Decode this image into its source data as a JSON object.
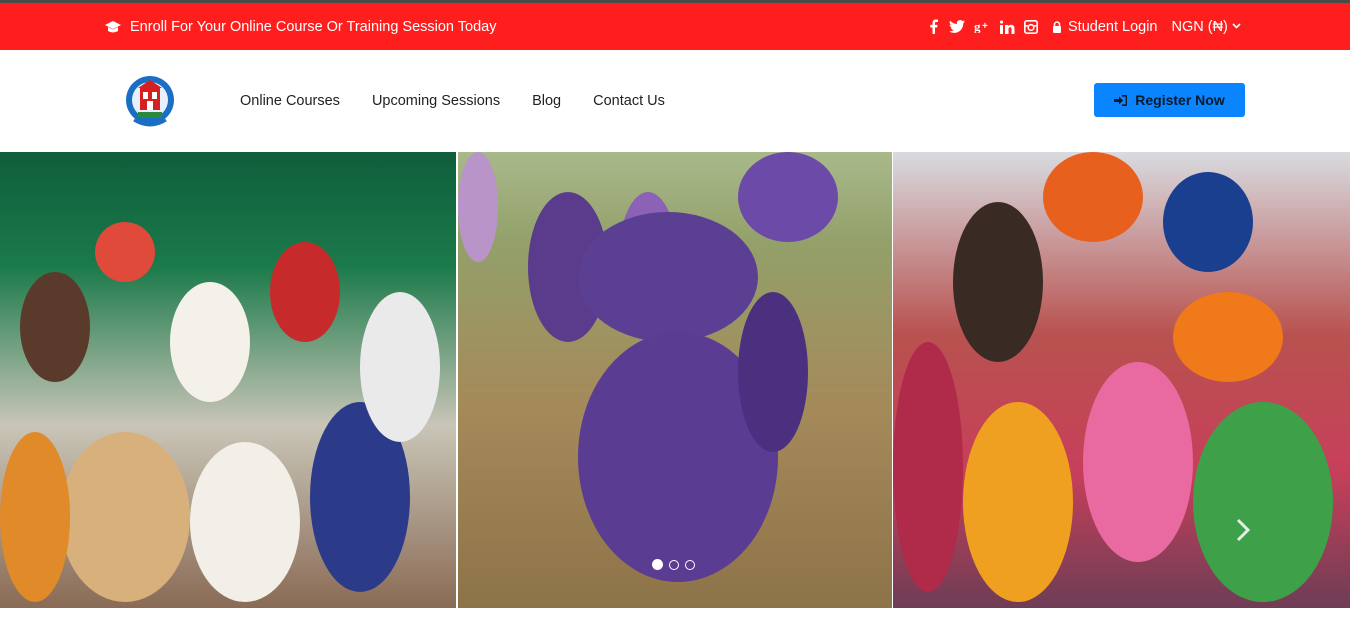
{
  "topbar": {
    "promo_text": "Enroll For Your Online Course Or Training Session Today",
    "promo_icon": "graduation-cap-icon",
    "social": [
      {
        "name": "facebook-icon",
        "glyph": "f"
      },
      {
        "name": "twitter-icon",
        "glyph": "t"
      },
      {
        "name": "google-plus-icon",
        "glyph": "g+"
      },
      {
        "name": "linkedin-icon",
        "glyph": "in"
      },
      {
        "name": "instagram-icon",
        "glyph": "◙"
      }
    ],
    "login_label": "Student Login",
    "currency_label": "NGN (₦)"
  },
  "nav": {
    "links": [
      "Online Courses",
      "Upcoming Sessions",
      "Blog",
      "Contact Us"
    ],
    "register_label": "Register Now"
  },
  "colors": {
    "topbar_bg": "#ff1e1e",
    "register_bg": "#0a84ff"
  },
  "carousel": {
    "slide_count": 3,
    "active_slide": 1
  }
}
